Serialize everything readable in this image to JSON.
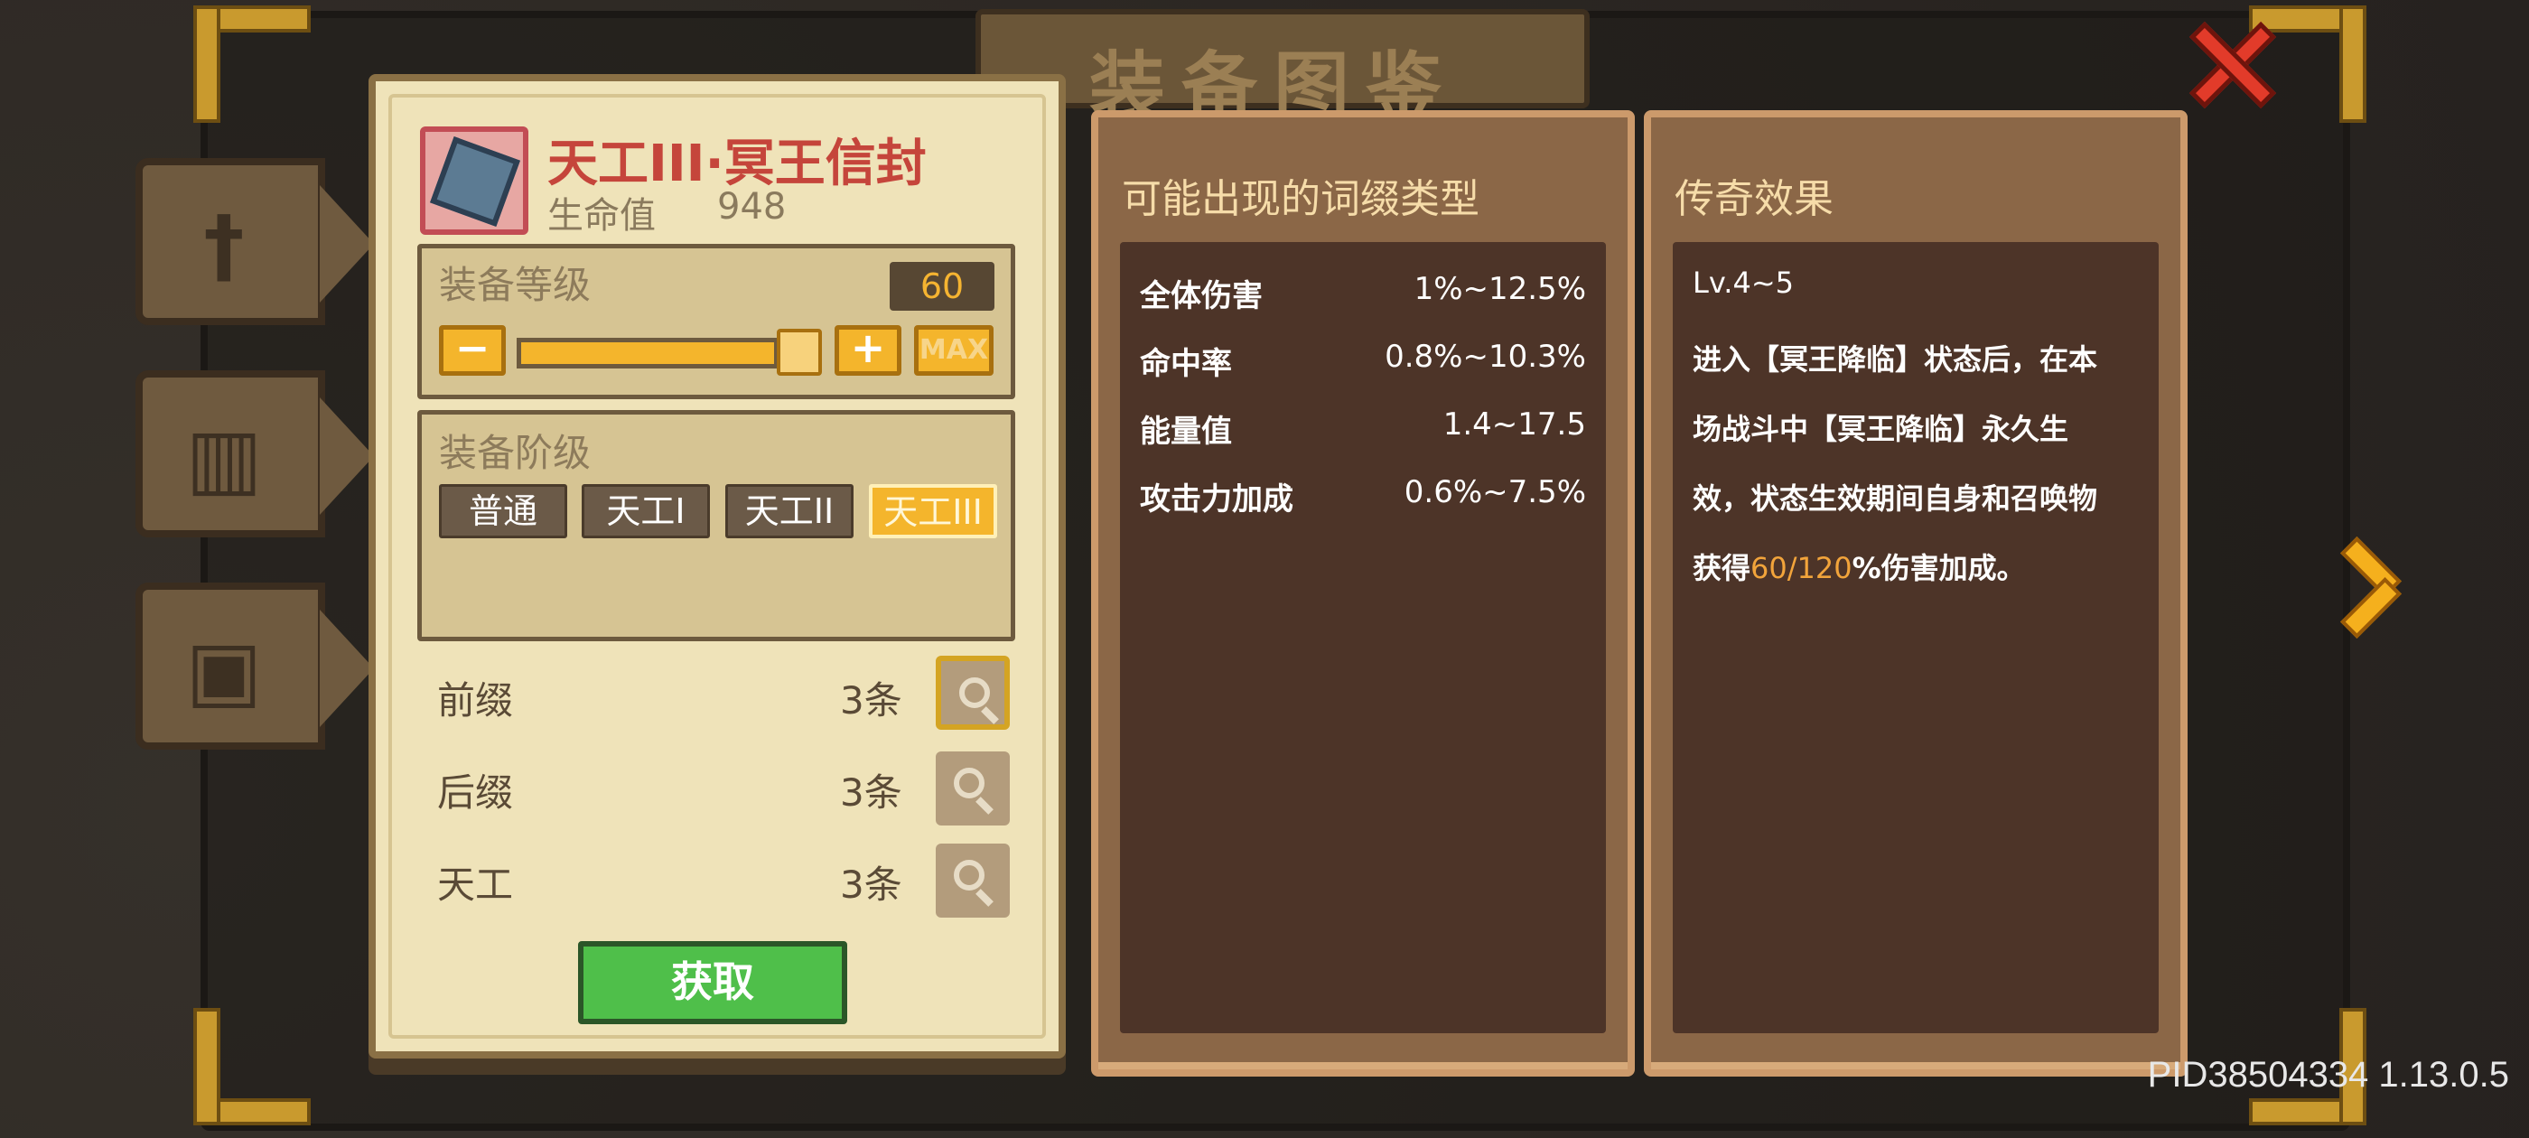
{
  "header": {
    "title": "装备图鉴",
    "close_icon": "close-icon"
  },
  "item": {
    "name": "天工III·冥王信封",
    "stat_label": "生命值",
    "stat_value": "948",
    "icon": "envelope-icon"
  },
  "level": {
    "label": "装备等级",
    "value": "60",
    "slider_fraction": 1.0,
    "minus": "−",
    "plus": "+",
    "max": "MAX"
  },
  "tier": {
    "label": "装备阶级",
    "options": [
      "普通",
      "天工I",
      "天工II",
      "天工III"
    ],
    "selected": "天工III"
  },
  "affix_counts": [
    {
      "label": "前缀",
      "count": "3条"
    },
    {
      "label": "后缀",
      "count": "3条"
    },
    {
      "label": "天工",
      "count": "3条"
    }
  ],
  "get_button": "获取",
  "affix_panel": {
    "title": "可能出现的词缀类型",
    "rows": [
      {
        "name": "全体伤害",
        "range": "1%~12.5%"
      },
      {
        "name": "命中率",
        "range": "0.8%~10.3%"
      },
      {
        "name": "能量值",
        "range": "1.4~17.5"
      },
      {
        "name": "攻击力加成",
        "range": "0.6%~7.5%"
      }
    ]
  },
  "legend_panel": {
    "title": "传奇效果",
    "level_range": "Lv.4~5",
    "text_before": "进入【冥王降临】状态后，在本场战斗中【冥王降临】永久生效，状态生效期间自身和召唤物获得",
    "highlight": "60/120",
    "text_after": "%伤害加成。"
  },
  "version": "PID38504334 1.13.0.5",
  "colors": {
    "accent": "#f4b52c",
    "name_red": "#c5453b",
    "green": "#4fbf4a",
    "highlight": "#f2a43b"
  }
}
